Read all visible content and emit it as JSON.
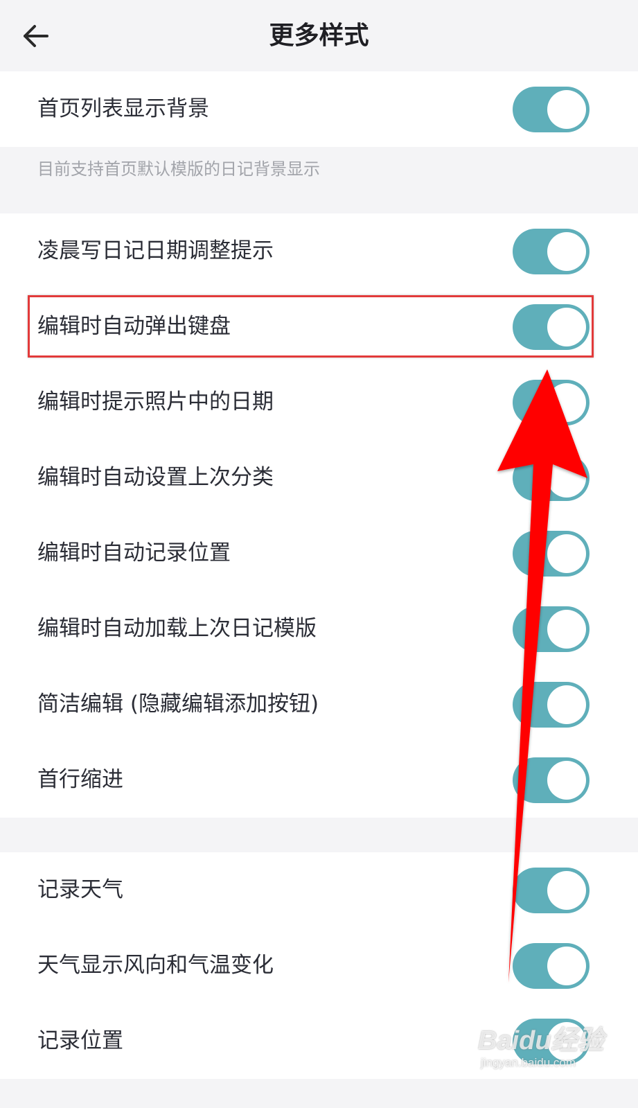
{
  "header": {
    "title": "更多样式",
    "back_icon": "arrow-left-icon"
  },
  "section1": {
    "items": [
      {
        "label": "首页列表显示背景",
        "enabled": true
      }
    ],
    "hint": "目前支持首页默认模版的日记背景显示"
  },
  "section2": {
    "items": [
      {
        "label": "凌晨写日记日期调整提示",
        "enabled": true
      },
      {
        "label": "编辑时自动弹出键盘",
        "enabled": true
      },
      {
        "label": "编辑时提示照片中的日期",
        "enabled": true
      },
      {
        "label": "编辑时自动设置上次分类",
        "enabled": true
      },
      {
        "label": "编辑时自动记录位置",
        "enabled": true
      },
      {
        "label": "编辑时自动加载上次日记模版",
        "enabled": true
      },
      {
        "label": "简洁编辑 (隐藏编辑添加按钮)",
        "enabled": true
      },
      {
        "label": "首行缩进",
        "enabled": true
      }
    ]
  },
  "section3": {
    "items": [
      {
        "label": "记录天气",
        "enabled": true
      },
      {
        "label": "天气显示风向和气温变化",
        "enabled": true
      },
      {
        "label": "记录位置",
        "enabled": true
      }
    ]
  },
  "annotation": {
    "highlight_color": "#e23a3a",
    "arrow_color": "#ff0000"
  },
  "watermark": {
    "logo": "Baidu经验",
    "url": "jingyan.baidu.com"
  },
  "colors": {
    "toggle_on": "#5fafba",
    "background": "#f4f4f6"
  }
}
